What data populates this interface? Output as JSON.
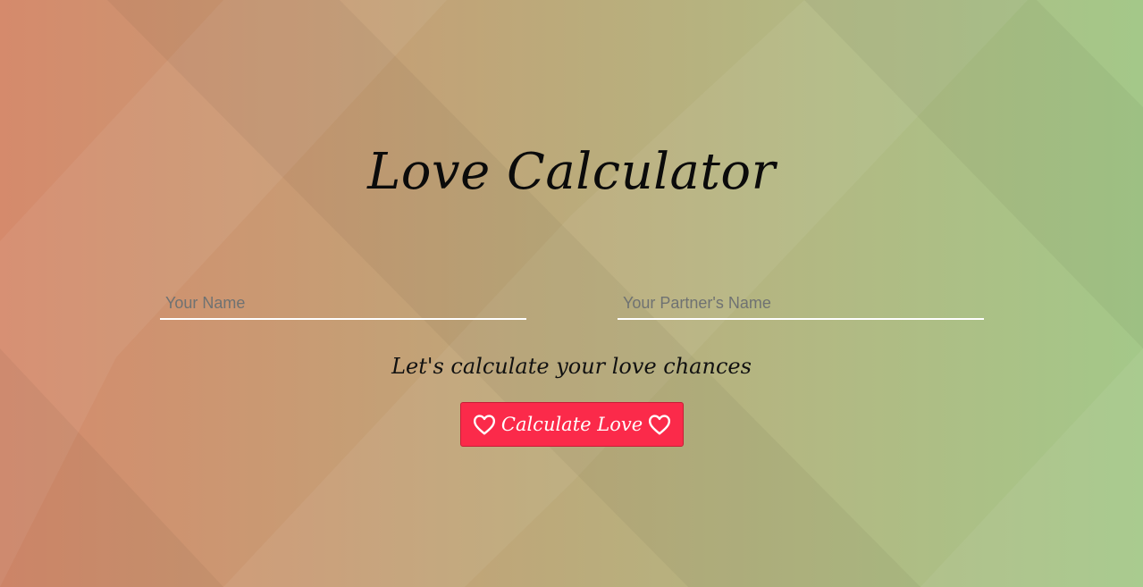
{
  "app": {
    "title": "Love Calculator",
    "subtitle": "Let's calculate your love chances"
  },
  "form": {
    "your_name_placeholder": "Your Name",
    "partner_name_placeholder": "Your Partner's Name",
    "your_name_value": "",
    "partner_name_value": ""
  },
  "button": {
    "label": "Calculate Love",
    "icon": "heart-outline-icon",
    "color": "#fb2a4a"
  },
  "colors": {
    "background_left": "#d58a6c",
    "background_right": "#a4c889",
    "input_underline": "#ffffff"
  }
}
